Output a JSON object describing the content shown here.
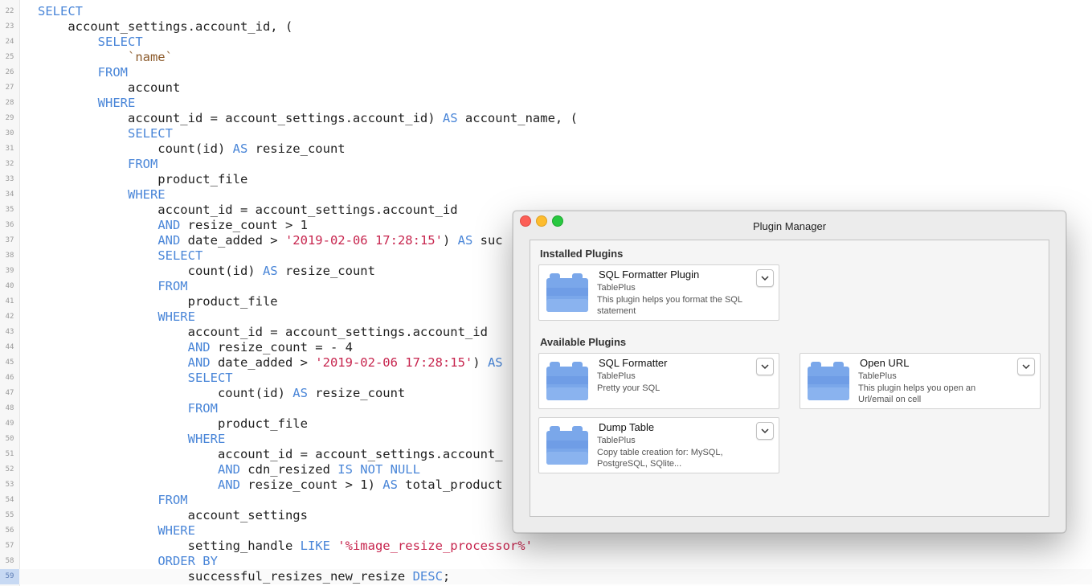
{
  "editor": {
    "lines": [
      {
        "num": "22",
        "tokens": [
          {
            "t": "SELECT",
            "c": "keyword"
          }
        ]
      },
      {
        "num": "23",
        "tokens": [
          {
            "t": "    account_settings.account_id, (",
            "c": "text"
          }
        ]
      },
      {
        "num": "24",
        "tokens": [
          {
            "t": "        ",
            "c": "text"
          },
          {
            "t": "SELECT",
            "c": "keyword"
          }
        ]
      },
      {
        "num": "25",
        "tokens": [
          {
            "t": "            ",
            "c": "text"
          },
          {
            "t": "`name`",
            "c": "quoted"
          }
        ]
      },
      {
        "num": "26",
        "tokens": [
          {
            "t": "        ",
            "c": "text"
          },
          {
            "t": "FROM",
            "c": "keyword"
          }
        ]
      },
      {
        "num": "27",
        "tokens": [
          {
            "t": "            account",
            "c": "text"
          }
        ]
      },
      {
        "num": "28",
        "tokens": [
          {
            "t": "        ",
            "c": "text"
          },
          {
            "t": "WHERE",
            "c": "keyword"
          }
        ]
      },
      {
        "num": "29",
        "tokens": [
          {
            "t": "            account_id = account_settings.account_id) ",
            "c": "text"
          },
          {
            "t": "AS",
            "c": "keyword"
          },
          {
            "t": " account_name, (",
            "c": "text"
          }
        ]
      },
      {
        "num": "30",
        "tokens": [
          {
            "t": "            ",
            "c": "text"
          },
          {
            "t": "SELECT",
            "c": "keyword"
          }
        ]
      },
      {
        "num": "31",
        "tokens": [
          {
            "t": "                count(id) ",
            "c": "text"
          },
          {
            "t": "AS",
            "c": "keyword"
          },
          {
            "t": " resize_count",
            "c": "text"
          }
        ]
      },
      {
        "num": "32",
        "tokens": [
          {
            "t": "            ",
            "c": "text"
          },
          {
            "t": "FROM",
            "c": "keyword"
          }
        ]
      },
      {
        "num": "33",
        "tokens": [
          {
            "t": "                product_file",
            "c": "text"
          }
        ]
      },
      {
        "num": "34",
        "tokens": [
          {
            "t": "            ",
            "c": "text"
          },
          {
            "t": "WHERE",
            "c": "keyword"
          }
        ]
      },
      {
        "num": "35",
        "tokens": [
          {
            "t": "                account_id = account_settings.account_id",
            "c": "text"
          }
        ]
      },
      {
        "num": "36",
        "tokens": [
          {
            "t": "                ",
            "c": "text"
          },
          {
            "t": "AND",
            "c": "keyword"
          },
          {
            "t": " resize_count > 1",
            "c": "text"
          }
        ]
      },
      {
        "num": "37",
        "tokens": [
          {
            "t": "                ",
            "c": "text"
          },
          {
            "t": "AND",
            "c": "keyword"
          },
          {
            "t": " date_added > ",
            "c": "text"
          },
          {
            "t": "'2019-02-06 17:28:15'",
            "c": "string"
          },
          {
            "t": ") ",
            "c": "text"
          },
          {
            "t": "AS",
            "c": "keyword"
          },
          {
            "t": " suc",
            "c": "text"
          }
        ]
      },
      {
        "num": "38",
        "tokens": [
          {
            "t": "                ",
            "c": "text"
          },
          {
            "t": "SELECT",
            "c": "keyword"
          }
        ]
      },
      {
        "num": "39",
        "tokens": [
          {
            "t": "                    count(id) ",
            "c": "text"
          },
          {
            "t": "AS",
            "c": "keyword"
          },
          {
            "t": " resize_count",
            "c": "text"
          }
        ]
      },
      {
        "num": "40",
        "tokens": [
          {
            "t": "                ",
            "c": "text"
          },
          {
            "t": "FROM",
            "c": "keyword"
          }
        ]
      },
      {
        "num": "41",
        "tokens": [
          {
            "t": "                    product_file",
            "c": "text"
          }
        ]
      },
      {
        "num": "42",
        "tokens": [
          {
            "t": "                ",
            "c": "text"
          },
          {
            "t": "WHERE",
            "c": "keyword"
          }
        ]
      },
      {
        "num": "43",
        "tokens": [
          {
            "t": "                    account_id = account_settings.account_id",
            "c": "text"
          }
        ]
      },
      {
        "num": "44",
        "tokens": [
          {
            "t": "                    ",
            "c": "text"
          },
          {
            "t": "AND",
            "c": "keyword"
          },
          {
            "t": " resize_count = - 4",
            "c": "text"
          }
        ]
      },
      {
        "num": "45",
        "tokens": [
          {
            "t": "                    ",
            "c": "text"
          },
          {
            "t": "AND",
            "c": "keyword"
          },
          {
            "t": " date_added > ",
            "c": "text"
          },
          {
            "t": "'2019-02-06 17:28:15'",
            "c": "string"
          },
          {
            "t": ") ",
            "c": "text"
          },
          {
            "t": "AS",
            "c": "keyword"
          }
        ]
      },
      {
        "num": "46",
        "tokens": [
          {
            "t": "                    ",
            "c": "text"
          },
          {
            "t": "SELECT",
            "c": "keyword"
          }
        ]
      },
      {
        "num": "47",
        "tokens": [
          {
            "t": "                        count(id) ",
            "c": "text"
          },
          {
            "t": "AS",
            "c": "keyword"
          },
          {
            "t": " resize_count",
            "c": "text"
          }
        ]
      },
      {
        "num": "48",
        "tokens": [
          {
            "t": "                    ",
            "c": "text"
          },
          {
            "t": "FROM",
            "c": "keyword"
          }
        ]
      },
      {
        "num": "49",
        "tokens": [
          {
            "t": "                        product_file",
            "c": "text"
          }
        ]
      },
      {
        "num": "50",
        "tokens": [
          {
            "t": "                    ",
            "c": "text"
          },
          {
            "t": "WHERE",
            "c": "keyword"
          }
        ]
      },
      {
        "num": "51",
        "tokens": [
          {
            "t": "                        account_id = account_settings.account_",
            "c": "text"
          }
        ]
      },
      {
        "num": "52",
        "tokens": [
          {
            "t": "                        ",
            "c": "text"
          },
          {
            "t": "AND",
            "c": "keyword"
          },
          {
            "t": " cdn_resized ",
            "c": "text"
          },
          {
            "t": "IS NOT NULL",
            "c": "keyword"
          }
        ]
      },
      {
        "num": "53",
        "tokens": [
          {
            "t": "                        ",
            "c": "text"
          },
          {
            "t": "AND",
            "c": "keyword"
          },
          {
            "t": " resize_count > 1) ",
            "c": "text"
          },
          {
            "t": "AS",
            "c": "keyword"
          },
          {
            "t": " total_product",
            "c": "text"
          }
        ]
      },
      {
        "num": "54",
        "tokens": [
          {
            "t": "                ",
            "c": "text"
          },
          {
            "t": "FROM",
            "c": "keyword"
          }
        ]
      },
      {
        "num": "55",
        "tokens": [
          {
            "t": "                    account_settings",
            "c": "text"
          }
        ]
      },
      {
        "num": "56",
        "tokens": [
          {
            "t": "                ",
            "c": "text"
          },
          {
            "t": "WHERE",
            "c": "keyword"
          }
        ]
      },
      {
        "num": "57",
        "tokens": [
          {
            "t": "                    setting_handle ",
            "c": "text"
          },
          {
            "t": "LIKE",
            "c": "keyword"
          },
          {
            "t": " ",
            "c": "text"
          },
          {
            "t": "'%image_resize_processor%'",
            "c": "string"
          }
        ]
      },
      {
        "num": "58",
        "tokens": [
          {
            "t": "                ",
            "c": "text"
          },
          {
            "t": "ORDER BY",
            "c": "keyword"
          }
        ]
      },
      {
        "num": "59",
        "tokens": [
          {
            "t": "                    successful_resizes_new_resize ",
            "c": "text"
          },
          {
            "t": "DESC",
            "c": "keyword"
          },
          {
            "t": ";",
            "c": "text"
          }
        ],
        "current": true
      }
    ]
  },
  "plugin_manager": {
    "title": "Plugin Manager",
    "installed_title": "Installed Plugins",
    "available_title": "Available Plugins",
    "installed": [
      {
        "name": "SQL Formatter Plugin",
        "author": "TablePlus",
        "description": "This plugin helps you format the SQL statement"
      }
    ],
    "available": [
      {
        "name": "SQL Formatter",
        "author": "TablePlus",
        "description": "Pretty your SQL"
      },
      {
        "name": "Open URL",
        "author": "TablePlus",
        "description": "This plugin helps you open an Url/email on cell"
      },
      {
        "name": "Dump Table",
        "author": "TablePlus",
        "description": "Copy table creation for: MySQL, PostgreSQL, SQlite..."
      }
    ]
  },
  "icons": {
    "window_close": "close-icon",
    "window_minimize": "minimize-icon",
    "window_zoom": "zoom-icon",
    "plugin": "plugin-block-icon",
    "menu": "chevron-down-icon"
  },
  "colors": {
    "keyword": "#4a86d8",
    "string": "#c7254e",
    "quoted_identifier": "#8b5a2b",
    "plugin_icon": "#7aa7ea"
  }
}
